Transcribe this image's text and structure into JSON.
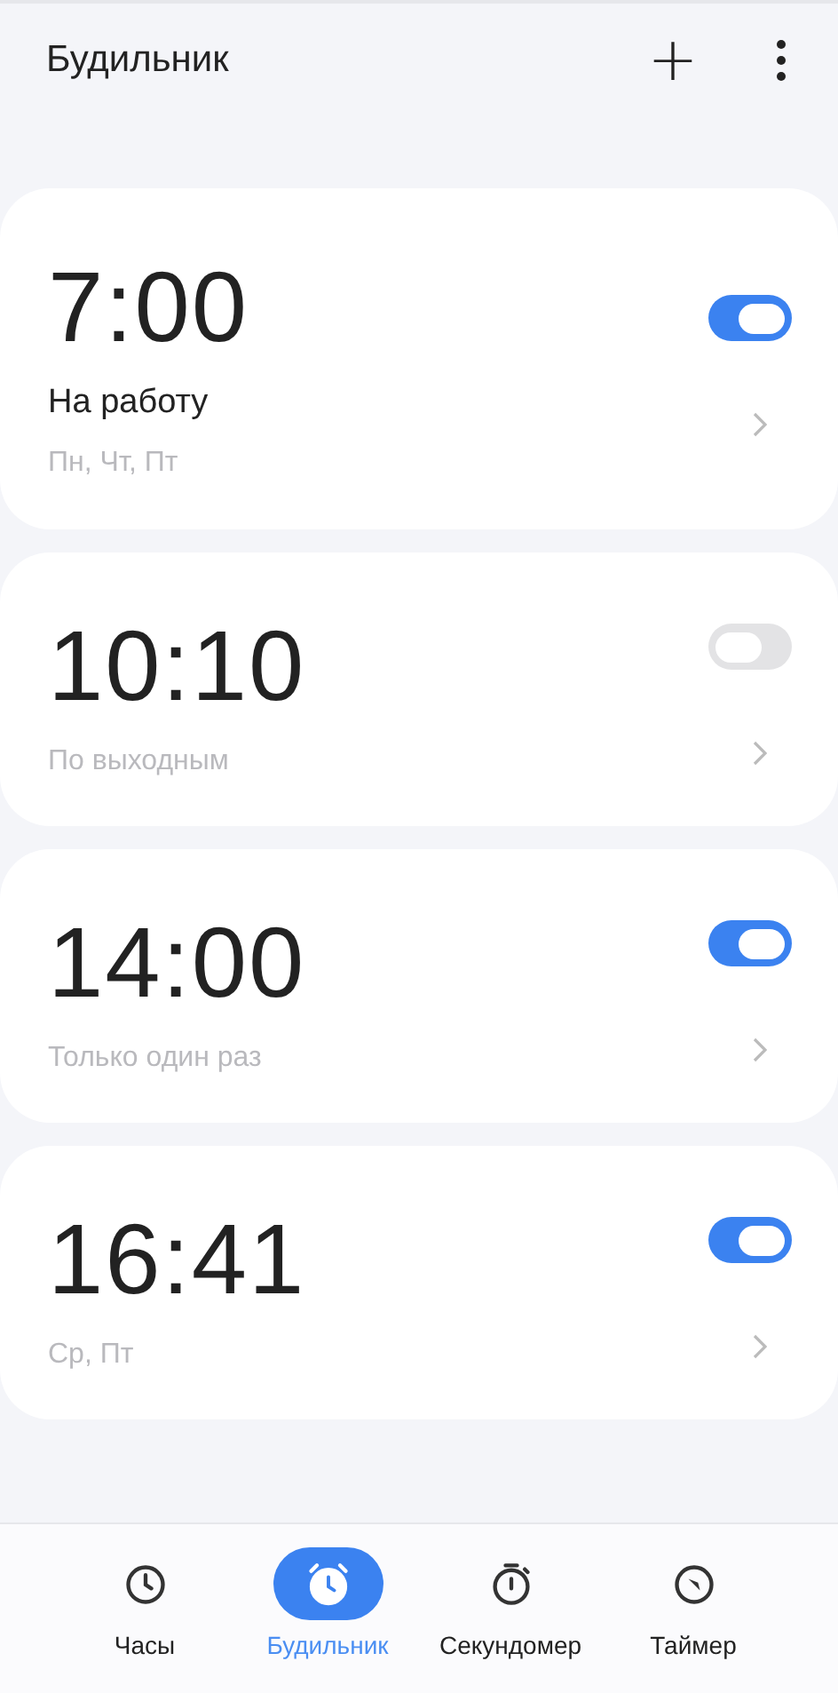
{
  "header": {
    "title": "Будильник",
    "add_icon": "+"
  },
  "alarms": [
    {
      "time": "7:00",
      "label": "На работу",
      "repeat": "Пн, Чт, Пт",
      "on": true
    },
    {
      "time": "10:10",
      "repeat": "По выходным",
      "on": false
    },
    {
      "time": "14:00",
      "repeat": "Только один раз",
      "on": true
    },
    {
      "time": "16:41",
      "repeat": "Ср, Пт",
      "on": true
    }
  ],
  "tabs": [
    {
      "kind": "clock",
      "label": "Часы",
      "selected": false
    },
    {
      "kind": "alarm",
      "label": "Будильник",
      "selected": true
    },
    {
      "kind": "stopwatch",
      "label": "Секундомер",
      "selected": false
    },
    {
      "kind": "timer",
      "label": "Таймер",
      "selected": false
    }
  ]
}
